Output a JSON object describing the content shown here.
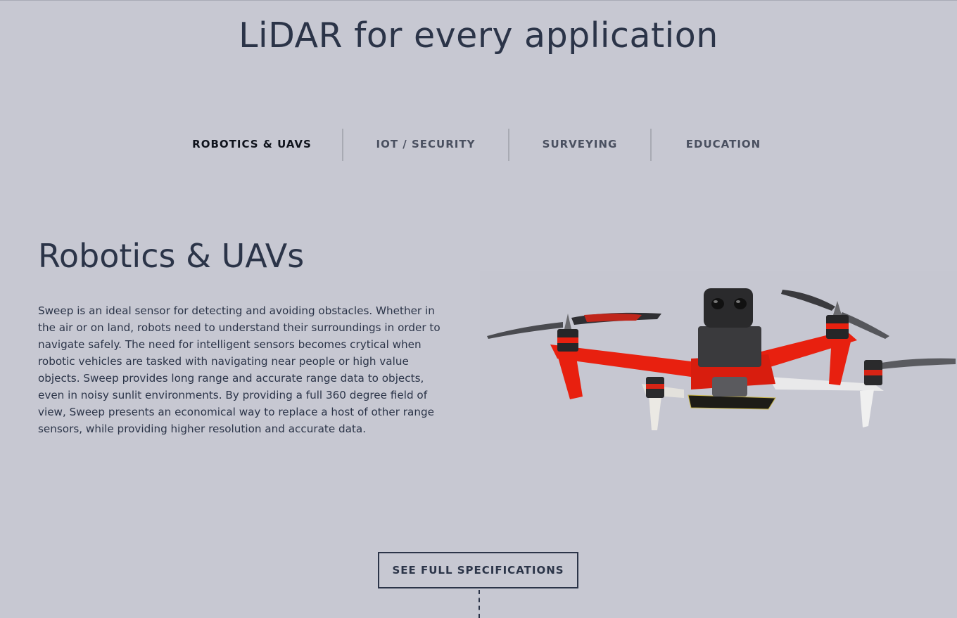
{
  "hero": {
    "title": "LiDAR for every application"
  },
  "tabs": [
    {
      "label": "ROBOTICS & UAVS",
      "active": true
    },
    {
      "label": "IOT / SECURITY",
      "active": false
    },
    {
      "label": "SURVEYING",
      "active": false
    },
    {
      "label": "EDUCATION",
      "active": false
    }
  ],
  "section": {
    "title": "Robotics & UAVs",
    "body": "Sweep is an ideal sensor for detecting and avoiding obstacles. Whether in the air or on land, robots need to understand their surroundings in order to navigate safely. The need for intelligent sensors becomes crytical when robotic vehicles are tasked with navigating near people or high value objects. Sweep provides long range and accurate range data to objects, even in noisy sunlit environments. By providing a full 360 degree field of view, Sweep presents an economical way to replace a host of other range sensors, while providing higher resolution and accurate data."
  },
  "cta": {
    "label": "SEE FULL SPECIFICATIONS"
  },
  "colors": {
    "background": "#c7c8d2",
    "text": "#2b3448",
    "drone_frame": "#e8200f",
    "drone_sensor": "#2a2a2c"
  }
}
